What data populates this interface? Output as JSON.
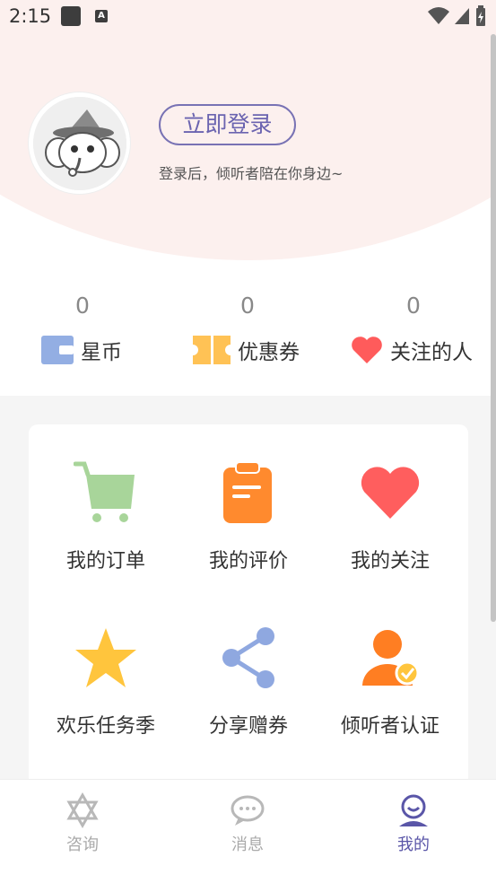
{
  "status_bar": {
    "time": "2:15",
    "a_badge": "A"
  },
  "profile": {
    "login_button": "立即登录",
    "login_hint": "登录后，倾听者陪在你身边~"
  },
  "stats": [
    {
      "value": "0",
      "label": "星币",
      "icon": "wallet-icon"
    },
    {
      "value": "0",
      "label": "优惠券",
      "icon": "ticket-icon"
    },
    {
      "value": "0",
      "label": "关注的人",
      "icon": "heart-icon"
    }
  ],
  "menu": [
    {
      "label": "我的订单",
      "icon": "cart-icon"
    },
    {
      "label": "我的评价",
      "icon": "clipboard-icon"
    },
    {
      "label": "我的关注",
      "icon": "heart-icon"
    },
    {
      "label": "欢乐任务季",
      "icon": "star-icon"
    },
    {
      "label": "分享赠券",
      "icon": "share-icon"
    },
    {
      "label": "倾听者认证",
      "icon": "verified-user-icon"
    }
  ],
  "tabs": [
    {
      "label": "咨询",
      "icon": "hexagram-icon",
      "active": false
    },
    {
      "label": "消息",
      "icon": "chat-bubble-icon",
      "active": false
    },
    {
      "label": "我的",
      "icon": "user-icon",
      "active": true
    }
  ],
  "colors": {
    "accent": "#5a56a8",
    "header_bg": "#fcf0ee",
    "cart": "#a8d59a",
    "clipboard": "#ff8a2e",
    "heart": "#ff5e5e",
    "star": "#ffc53d",
    "share": "#8fa8e0"
  }
}
